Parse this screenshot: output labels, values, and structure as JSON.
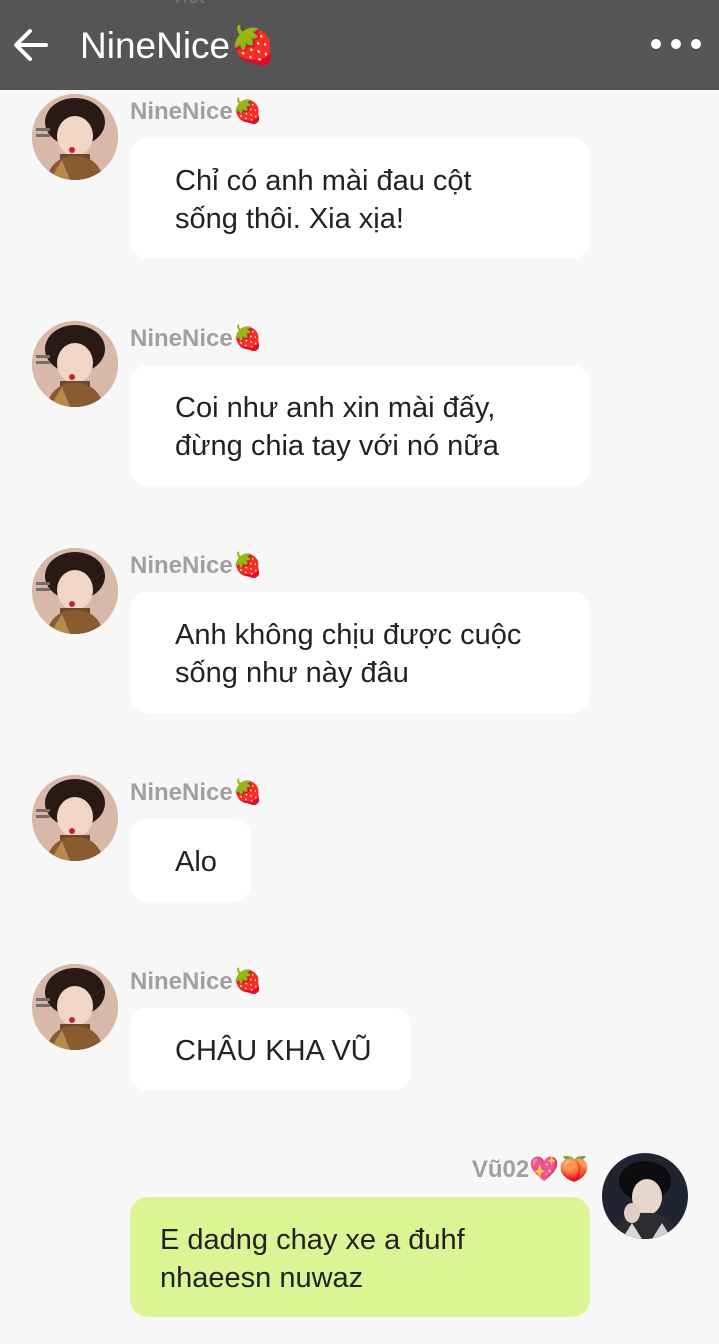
{
  "header": {
    "title": "NineNice",
    "title_emoji": "🍓",
    "ghost_text": "rict"
  },
  "messages": [
    {
      "sender": "NineNice",
      "sender_emoji": "🍓",
      "lines": [
        "Chỉ có anh mài đau cột",
        "sống thôi. Xia xịa!"
      ]
    },
    {
      "sender": "NineNice",
      "sender_emoji": "🍓",
      "lines": [
        "Coi như anh xin mài đấy,",
        "đừng chia tay với nó nữa"
      ]
    },
    {
      "sender": "NineNice",
      "sender_emoji": "🍓",
      "lines": [
        "Anh không chịu được cuộc",
        "sống như này đâu"
      ]
    },
    {
      "sender": "NineNice",
      "sender_emoji": "🍓",
      "lines": [
        "Alo"
      ]
    },
    {
      "sender": "NineNice",
      "sender_emoji": "🍓",
      "lines": [
        "CHÂU KHA VŨ"
      ]
    }
  ],
  "my_message": {
    "sender": "Vũ02",
    "sender_emoji": "💖🍑",
    "lines": [
      "E dadng chay xe a đuhf",
      "nhaeesn nuwaz"
    ]
  },
  "colors": {
    "header_bg": "#555555",
    "page_bg": "#f7f7f7",
    "my_bubble_bg": "#dbf595",
    "their_bubble_bg": "#ffffff"
  },
  "icons": {
    "back": "arrow-left-icon",
    "more": "more-dots-icon"
  }
}
